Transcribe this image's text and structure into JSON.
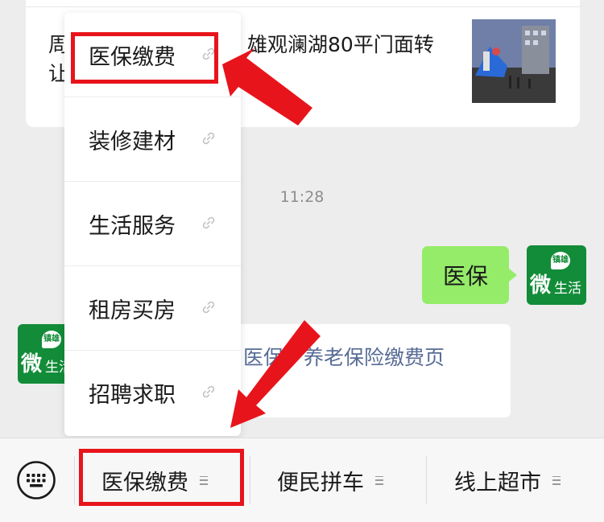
{
  "article": {
    "title_line1": "周",
    "title_line1_tail": "雄观澜湖80平门面转",
    "title_line2": "让"
  },
  "chat": {
    "timestamp": "11:28",
    "sent_message": "医保",
    "reply_link": "医保、养老保险缴费页"
  },
  "avatar": {
    "wei": "微",
    "life": "生活",
    "badge": "镇雄"
  },
  "popup_menu": {
    "items": [
      {
        "label": "医保缴费"
      },
      {
        "label": "装修建材"
      },
      {
        "label": "生活服务"
      },
      {
        "label": "租房买房"
      },
      {
        "label": "招聘求职"
      }
    ]
  },
  "bottom_menu": {
    "items": [
      {
        "label": "医保缴费"
      },
      {
        "label": "便民拼车"
      },
      {
        "label": "线上超市"
      }
    ]
  },
  "annotation_color": "#e8141b",
  "icons": [
    "keyboard-icon",
    "link-icon",
    "menu-lines-icon",
    "arrow-annotation"
  ]
}
